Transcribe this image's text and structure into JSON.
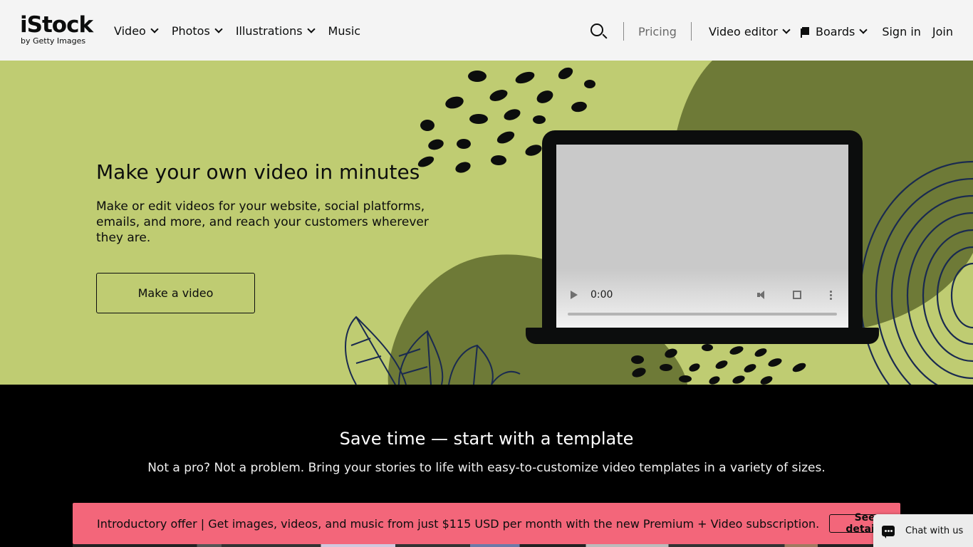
{
  "brand": {
    "name": "iStock",
    "tagline": "by Getty Images"
  },
  "nav": {
    "primary": [
      {
        "label": "Video",
        "has_dropdown": true
      },
      {
        "label": "Photos",
        "has_dropdown": true
      },
      {
        "label": "Illustrations",
        "has_dropdown": true
      },
      {
        "label": "Music",
        "has_dropdown": false
      }
    ],
    "search_icon": "search-icon",
    "pricing": "Pricing",
    "video_editor": "Video editor",
    "boards": "Boards",
    "sign_in": "Sign in",
    "join": "Join"
  },
  "hero": {
    "title": "Make your own video in minutes",
    "description": "Make or edit videos for your website, social platforms, emails, and more, and reach your customers wherever they are.",
    "cta": "Make a video",
    "background_color": "#bfcc72",
    "video": {
      "time": "0:00"
    }
  },
  "templates": {
    "title": "Save time — start with a template",
    "description": "Not a pro? Not a problem. Bring your stories to life with easy-to-customize video templates in a variety of sizes."
  },
  "promo": {
    "text": "Introductory offer | Get images, videos, and music from just $115 USD per month with the new Premium + Video subscription.",
    "button": "See details",
    "background_color": "#f3667a"
  },
  "chat": {
    "label": "Chat with us"
  }
}
